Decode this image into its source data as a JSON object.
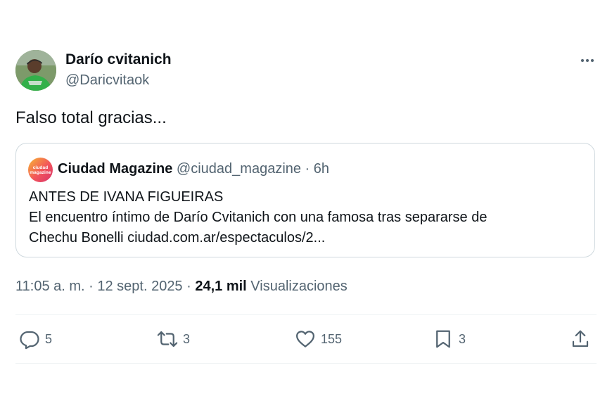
{
  "author": {
    "display_name": "Darío cvitanich",
    "handle": "@Daricvitaok",
    "avatar_icon": "user-avatar"
  },
  "more_icon": "more-horizontal-icon",
  "tweet": {
    "text": "Falso total gracias..."
  },
  "quote": {
    "logo_text_line1": "ciudad",
    "logo_text_line2": "magazine",
    "name": "Ciudad Magazine",
    "meta": "@ciudad_magazine · 6h",
    "line1": "ANTES DE IVANA FIGUEIRAS",
    "line2": "El encuentro íntimo de Darío Cvitanich con una famosa tras separarse de",
    "line3": "Chechu Bonelli ciudad.com.ar/espectaculos/2..."
  },
  "meta": {
    "time_date": "11:05 a. m. · 12 sept. 2025 · ",
    "views_count": "24,1 mil",
    "views_label": " Visualizaciones"
  },
  "actions": {
    "replies": "5",
    "retweets": "3",
    "likes": "155",
    "bookmarks": "3"
  },
  "colors": {
    "text": "#0f1419",
    "secondary": "#536471",
    "border": "#cfd9de"
  }
}
